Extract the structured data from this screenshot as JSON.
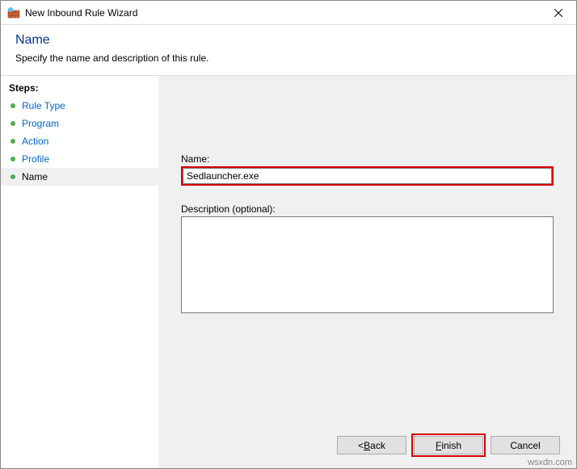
{
  "titlebar": {
    "title": "New Inbound Rule Wizard"
  },
  "header": {
    "title": "Name",
    "subtitle": "Specify the name and description of this rule."
  },
  "sidebar": {
    "label": "Steps:",
    "items": [
      {
        "label": "Rule Type"
      },
      {
        "label": "Program"
      },
      {
        "label": "Action"
      },
      {
        "label": "Profile"
      },
      {
        "label": "Name"
      }
    ]
  },
  "form": {
    "name_label": "Name:",
    "name_value": "Sedlauncher.exe",
    "desc_label": "Description (optional):",
    "desc_value": ""
  },
  "buttons": {
    "back_prefix": "< ",
    "back_mnemonic": "B",
    "back_suffix": "ack",
    "finish_mnemonic": "F",
    "finish_suffix": "inish",
    "cancel": "Cancel"
  },
  "watermark": "wsxdn.com"
}
